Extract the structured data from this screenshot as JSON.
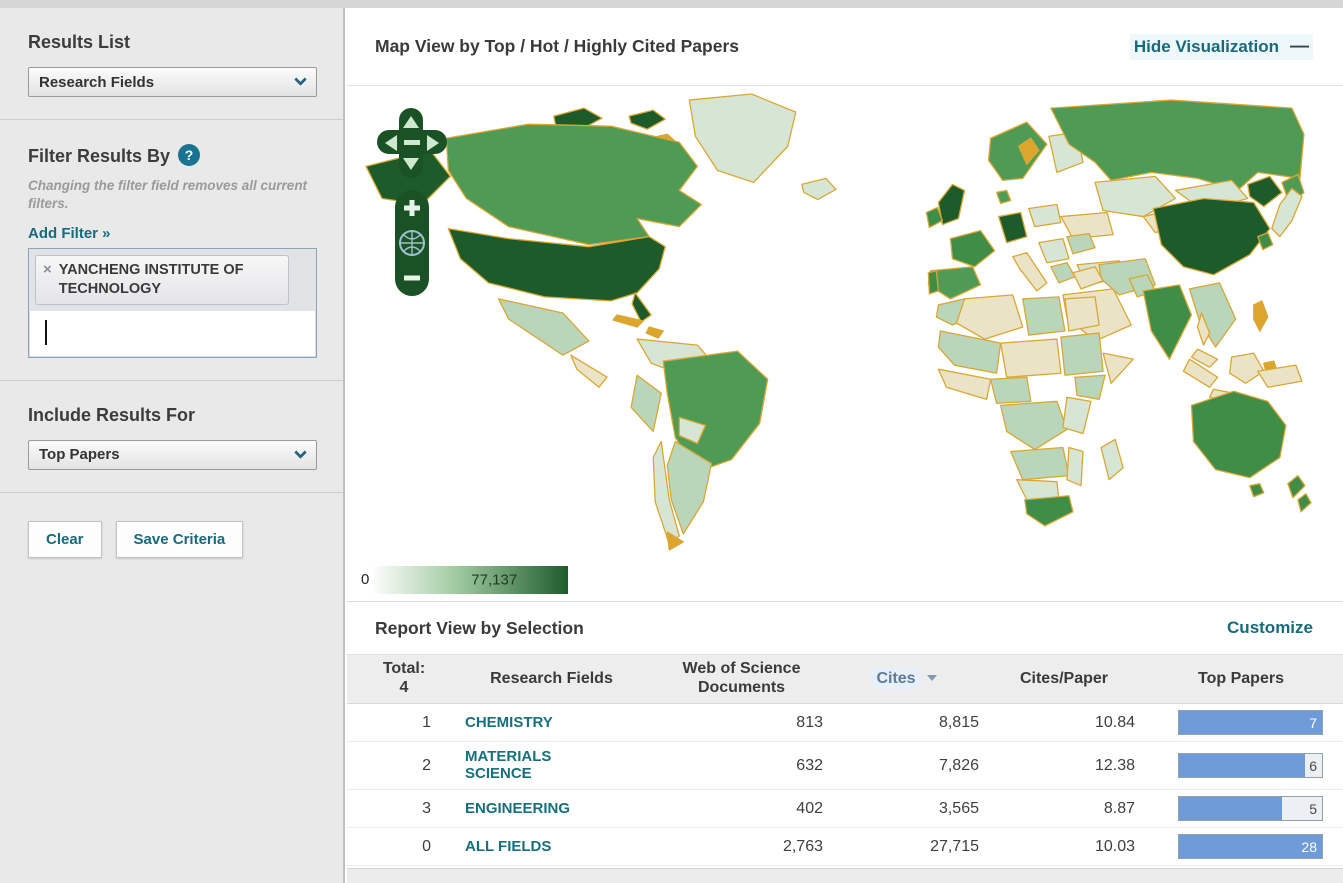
{
  "colors": {
    "accent_teal": "#176b7c",
    "map_min_color": "#ffffff",
    "map_max_color": "#1e5c2b",
    "map_border_orange": "#dba733",
    "bar_fill_blue": "#6f9bd9",
    "sidebar_bg": "#e9e9e9"
  },
  "icons": {
    "help": "?",
    "tag_remove": "×",
    "hide_minus": "—",
    "zoom_in": "+",
    "zoom_out": "−"
  },
  "sidebar": {
    "results_list": {
      "title": "Results List",
      "dropdown_value": "Research Fields"
    },
    "filter": {
      "title": "Filter Results By",
      "note": "Changing the filter field removes all current filters.",
      "add_filter_label": "Add Filter »",
      "tags": [
        {
          "label": "YANCHENG INSTITUTE OF TECHNOLOGY"
        }
      ]
    },
    "include": {
      "title": "Include Results For",
      "dropdown_value": "Top Papers"
    },
    "buttons": {
      "clear": "Clear",
      "save": "Save Criteria"
    }
  },
  "map_panel": {
    "title": "Map View by Top / Hot / Highly Cited Papers",
    "hide_link": "Hide Visualization",
    "legend": {
      "min": "0",
      "max_label": "77,137"
    }
  },
  "report": {
    "title": "Report View by Selection",
    "customize_link": "Customize",
    "table": {
      "total_label": "Total:",
      "total_value": "4",
      "columns": {
        "field": "Research Fields",
        "docs": "Web of Science Documents",
        "cites": "Cites",
        "cites_per_paper": "Cites/Paper",
        "top_papers": "Top Papers"
      },
      "sorted_column": "Cites",
      "rows": [
        {
          "rank": "1",
          "field": "CHEMISTRY",
          "docs": "813",
          "cites": "8,815",
          "cites_per_paper": "10.84",
          "top_papers": "7",
          "bar_pct": 100,
          "label_on_fill": true
        },
        {
          "rank": "2",
          "field": "MATERIALS SCIENCE",
          "docs": "632",
          "cites": "7,826",
          "cites_per_paper": "12.38",
          "top_papers": "6",
          "bar_pct": 88,
          "label_on_fill": false
        },
        {
          "rank": "3",
          "field": "ENGINEERING",
          "docs": "402",
          "cites": "3,565",
          "cites_per_paper": "8.87",
          "top_papers": "5",
          "bar_pct": 72,
          "label_on_fill": false
        },
        {
          "rank": "0",
          "field": "ALL FIELDS",
          "docs": "2,763",
          "cites": "27,715",
          "cites_per_paper": "10.03",
          "top_papers": "28",
          "bar_pct": 100,
          "label_on_fill": true
        }
      ]
    }
  }
}
